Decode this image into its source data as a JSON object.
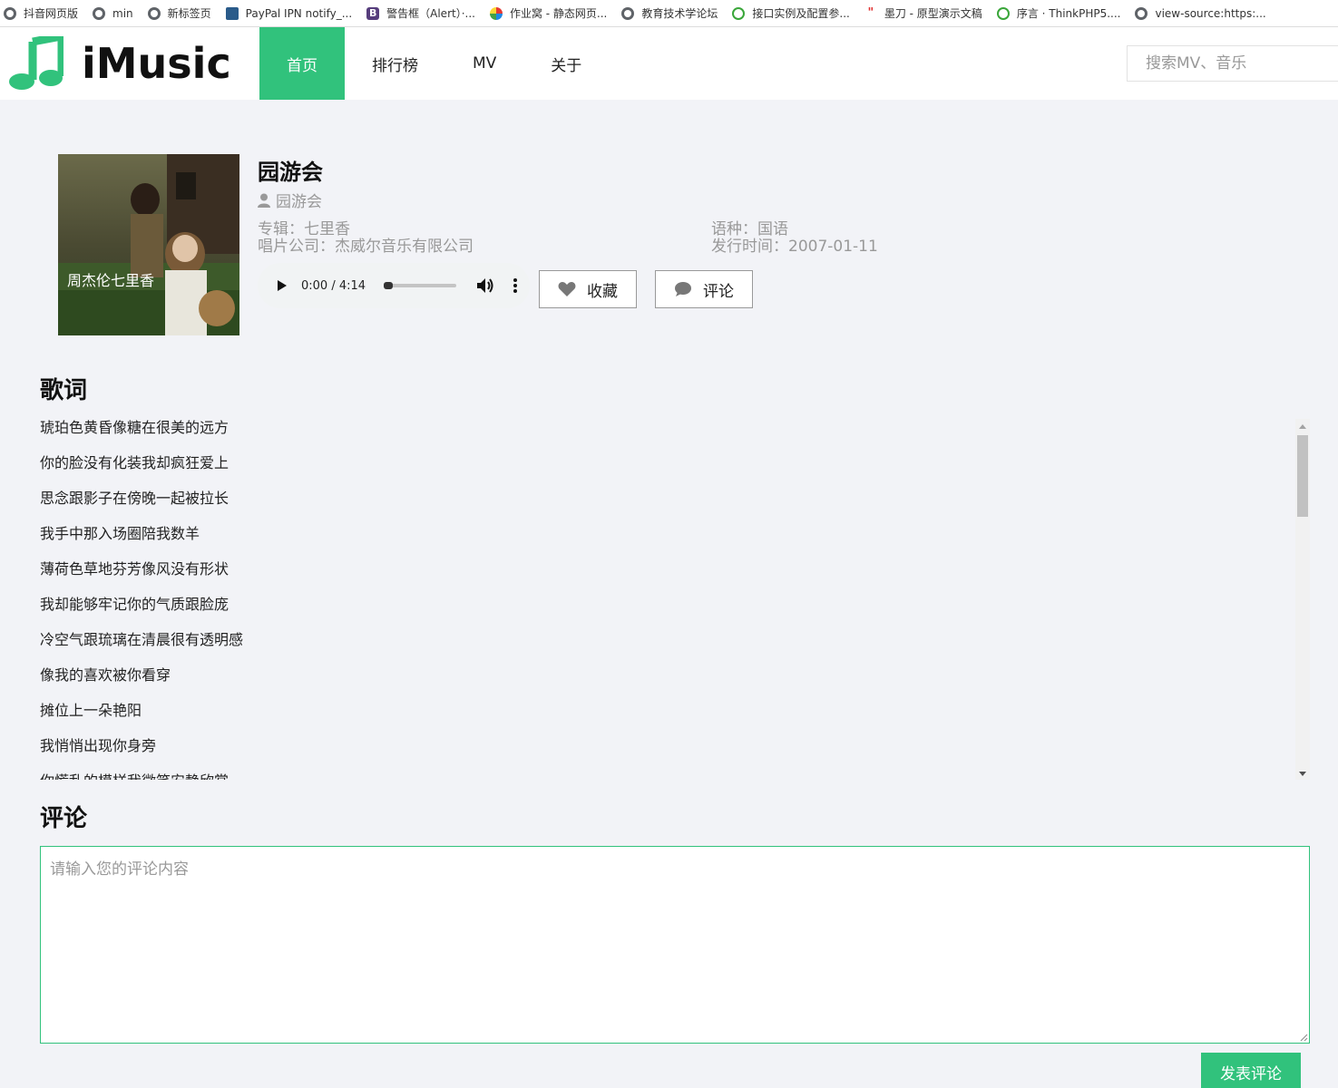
{
  "bookmarks": [
    {
      "label": "抖音网页版",
      "icon": "globe-icon"
    },
    {
      "label": "min",
      "icon": "globe-icon"
    },
    {
      "label": "新标签页",
      "icon": "globe-icon"
    },
    {
      "label": "PayPal IPN notify_...",
      "icon": "avatar-icon"
    },
    {
      "label": "警告框（Alert）·...",
      "icon": "bootstrap-icon"
    },
    {
      "label": "作业窝 - 静态网页...",
      "icon": "colorful-logo-icon"
    },
    {
      "label": "教育技术学论坛",
      "icon": "globe-icon"
    },
    {
      "label": "接口实例及配置参...",
      "icon": "green-logo-icon"
    },
    {
      "label": "墨刀 - 原型演示文稿",
      "icon": "modao-icon"
    },
    {
      "label": "序言 · ThinkPHP5....",
      "icon": "green-logo-icon"
    },
    {
      "label": "view-source:https:...",
      "icon": "globe-icon"
    }
  ],
  "header": {
    "logo_text": "iMusic",
    "nav": [
      {
        "label": "首页",
        "active": true
      },
      {
        "label": "排行榜",
        "active": false
      },
      {
        "label": "MV",
        "active": false
      },
      {
        "label": "关于",
        "active": false
      }
    ],
    "search_placeholder": "搜索MV、音乐"
  },
  "song": {
    "title": "园游会",
    "singer": "园游会",
    "album_label": "专辑：",
    "album": "七里香",
    "language_label": "语种：",
    "language": "国语",
    "company_label": "唱片公司：",
    "company": "杰威尔音乐有限公司",
    "release_label": "发行时间：",
    "release_date": "2007-01-11"
  },
  "player": {
    "time": "0:00 / 4:14",
    "progress": 0
  },
  "actions": {
    "collect_label": "收藏",
    "comment_label": "评论"
  },
  "lyrics": {
    "title": "歌词",
    "lines": [
      "琥珀色黄昏像糖在很美的远方",
      "你的脸没有化装我却疯狂爱上",
      "思念跟影子在傍晚一起被拉长",
      "我手中那入场圈陪我数羊",
      "薄荷色草地芬芳像风没有形状",
      "我却能够牢记你的气质跟脸庞",
      "冷空气跟琉璃在清晨很有透明感",
      "像我的喜欢被你看穿",
      "摊位上一朵艳阳",
      "我悄悄出现你身旁",
      "你慌乱的模样我微笑安静欣赏"
    ]
  },
  "comments": {
    "title": "评论",
    "placeholder": "请输入您的评论内容",
    "submit_label": "发表评论"
  },
  "colors": {
    "accent": "#31c27c",
    "background": "#f2f3f7"
  }
}
